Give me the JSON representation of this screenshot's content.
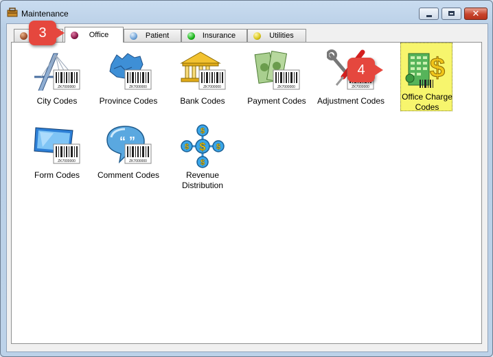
{
  "window": {
    "title": "Maintenance",
    "close_glyph": "✕"
  },
  "tabs": [
    {
      "label": "",
      "color": "#a0522d",
      "icon": "brown-ball-icon"
    },
    {
      "label": "Office",
      "color": "#8b1a4a",
      "icon": "maroon-ball-icon",
      "active": true
    },
    {
      "label": "Patient",
      "color": "#6fa3d8",
      "icon": "blue-ball-icon"
    },
    {
      "label": "Insurance",
      "color": "#19b419",
      "icon": "green-ball-icon"
    },
    {
      "label": "Utilities",
      "color": "#d9c61a",
      "icon": "yellow-ball-icon"
    }
  ],
  "items": [
    {
      "label": "City Codes",
      "icon": "bridge-barcode-icon"
    },
    {
      "label": "Province Codes",
      "icon": "map-barcode-icon"
    },
    {
      "label": "Bank Codes",
      "icon": "bank-barcode-icon"
    },
    {
      "label": "Payment Codes",
      "icon": "money-barcode-icon"
    },
    {
      "label": "Adjustment Codes",
      "icon": "tools-barcode-icon"
    },
    {
      "label": "Office Charge Codes",
      "icon": "building-dollar-icon",
      "selected": true
    },
    {
      "label": "Form Codes",
      "icon": "monitor-barcode-icon"
    },
    {
      "label": "Comment Codes",
      "icon": "speech-bubble-barcode-icon"
    },
    {
      "label": "Revenue Distribution",
      "icon": "dollar-network-icon"
    }
  ],
  "barcode_text": "ZK7000000",
  "callouts": [
    "3",
    "4"
  ]
}
